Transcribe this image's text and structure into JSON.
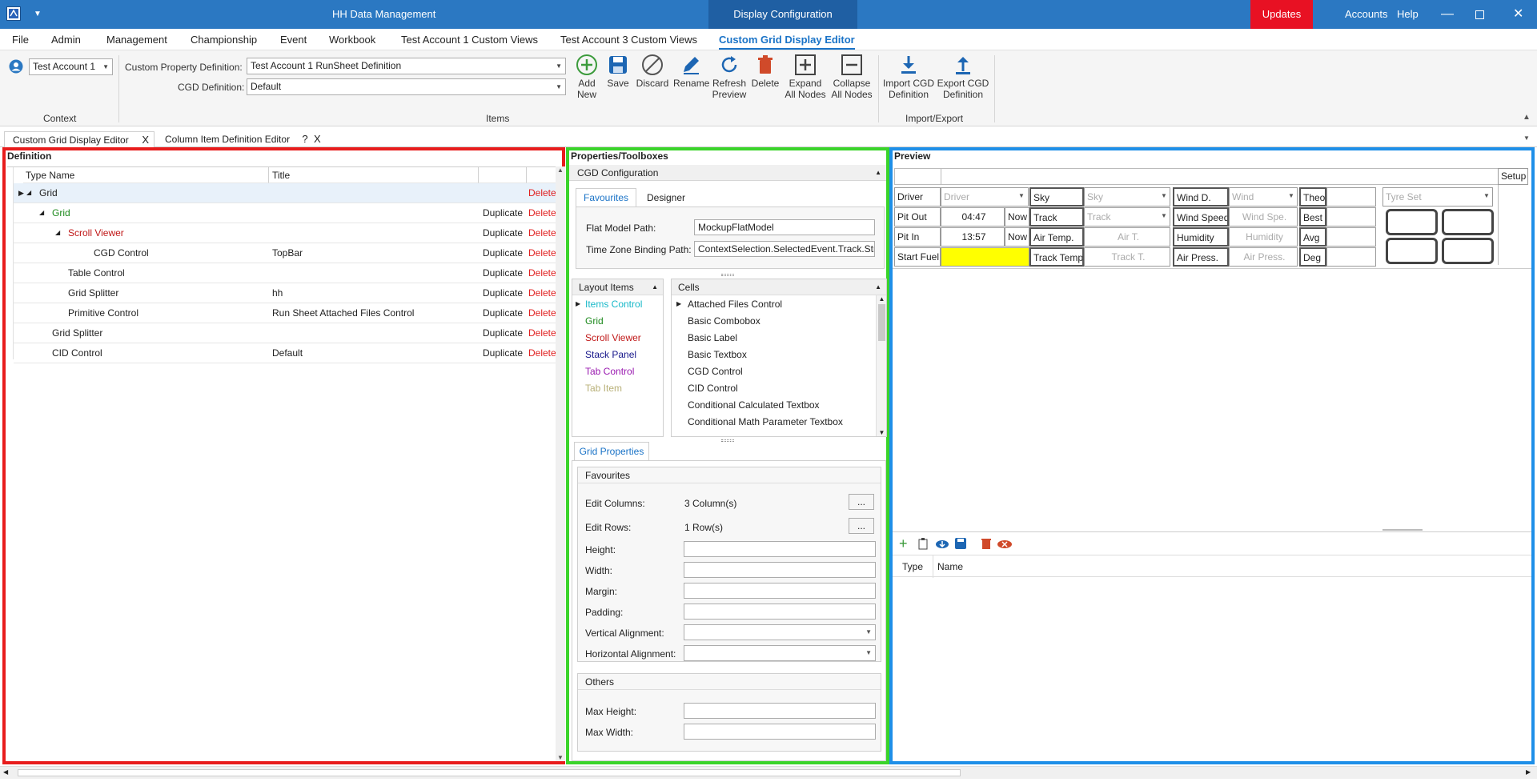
{
  "app": {
    "title": "HH Data Management",
    "window_title": "Display Configuration",
    "updates": "Updates Available",
    "accounts": "Accounts",
    "help": "Help"
  },
  "menu": [
    "File",
    "Admin",
    "Management",
    "Championship",
    "Event",
    "Workbook",
    "Test Account 1 Custom Views",
    "Test Account 3 Custom Views",
    "Custom Grid Display Editor"
  ],
  "ribbon": {
    "account": "Test Account 1",
    "context_label": "Context",
    "cpd_label": "Custom Property Definition:",
    "cpd_value": "Test Account 1 RunSheet Definition",
    "cgd_label": "CGD Definition:",
    "cgd_value": "Default",
    "items_label": "Items",
    "ie_label": "Import/Export",
    "buttons": {
      "add": "Add New",
      "save": "Save",
      "discard": "Discard",
      "rename": "Rename",
      "refresh": "Refresh Preview",
      "delete": "Delete",
      "expand": "Expand All Nodes",
      "collapse": "Collapse All Nodes",
      "import": "Import CGD Definition",
      "export": "Export CGD Definition"
    }
  },
  "doc_tabs": {
    "tab1": "Custom Grid Display Editor",
    "tab1_close": "X",
    "tab2": "Column Item Definition Editor",
    "tab2_help": "?",
    "tab2_close": "X"
  },
  "definition": {
    "title": "Definition",
    "col_type": "Type Name",
    "col_title": "Title",
    "rows": [
      {
        "type": "Grid",
        "title": "",
        "dup": "",
        "del": "Delete"
      },
      {
        "type": "Grid",
        "title": "",
        "dup": "Duplicate",
        "del": "Delete"
      },
      {
        "type": "Scroll Viewer",
        "title": "",
        "dup": "Duplicate",
        "del": "Delete"
      },
      {
        "type": "CGD Control",
        "title": "TopBar",
        "dup": "Duplicate",
        "del": "Delete"
      },
      {
        "type": "Table Control",
        "title": "",
        "dup": "Duplicate",
        "del": "Delete"
      },
      {
        "type": "Grid Splitter",
        "title": "hh",
        "dup": "Duplicate",
        "del": "Delete"
      },
      {
        "type": "Primitive Control",
        "title": "Run Sheet Attached Files Control",
        "dup": "Duplicate",
        "del": "Delete"
      },
      {
        "type": "Grid Splitter",
        "title": "",
        "dup": "Duplicate",
        "del": "Delete"
      },
      {
        "type": "CID Control",
        "title": "Default",
        "dup": "Duplicate",
        "del": "Delete"
      }
    ]
  },
  "properties": {
    "title": "Properties/Toolboxes",
    "cgd_config": "CGD Configuration",
    "tab_favourites": "Favourites",
    "tab_designer": "Designer",
    "flat_label": "Flat Model Path:",
    "flat_value": "MockupFlatModel",
    "tz_label": "Time Zone Binding Path:",
    "tz_value": "ContextSelection.SelectedEvent.Track.Strin",
    "layout_header": "Layout Items",
    "layout_items": [
      "Items Control",
      "Grid",
      "Scroll Viewer",
      "Stack Panel",
      "Tab Control",
      "Tab Item"
    ],
    "cells_header": "Cells",
    "cells": [
      "Attached Files Control",
      "Basic Combobox",
      "Basic Label",
      "Basic Textbox",
      "CGD Control",
      "CID Control",
      "Conditional Calculated Textbox",
      "Conditional Math Parameter Textbox"
    ],
    "grid_props_tab": "Grid Properties",
    "fav_header": "Favourites",
    "edit_cols_label": "Edit Columns:",
    "edit_cols_value": "3 Column(s)",
    "edit_rows_label": "Edit Rows:",
    "edit_rows_value": "1 Row(s)",
    "ellipsis": "...",
    "height": "Height:",
    "width": "Width:",
    "margin": "Margin:",
    "padding": "Padding:",
    "valign": "Vertical Alignment:",
    "halign": "Horizontal Alignment:",
    "others_header": "Others",
    "max_height": "Max Height:",
    "max_width": "Max Width:"
  },
  "preview": {
    "title": "Preview",
    "setup": "Setup",
    "r1": [
      "Driver",
      "Driver",
      "Sky",
      "Sky",
      "Wind D.",
      "Wind",
      "Theo",
      "",
      "Tyre Set"
    ],
    "r2": [
      "Pit Out",
      "04:47",
      "Now",
      "Track",
      "Track",
      "Wind Speed",
      "Wind Spe.",
      "Best"
    ],
    "r3": [
      "Pit In",
      "13:57",
      "Now",
      "Air Temp.",
      "Air T.",
      "Humidity",
      "Humidity",
      "Avg"
    ],
    "r4": [
      "Start Fuel",
      "",
      "Track Temp.",
      "Track T.",
      "Air Press.",
      "Air Press.",
      "Deg"
    ],
    "files_col_type": "Type",
    "files_col_name": "Name"
  },
  "colors": {
    "titlebar": "#2b78c2",
    "updates": "#e81123",
    "definition_border": "#e81c1c",
    "properties_border": "#3ad42a",
    "preview_border": "#1e8fe8",
    "accent": "#1a73c7",
    "delete_red": "#e02020",
    "fuel_yellow": "#ffff00"
  }
}
